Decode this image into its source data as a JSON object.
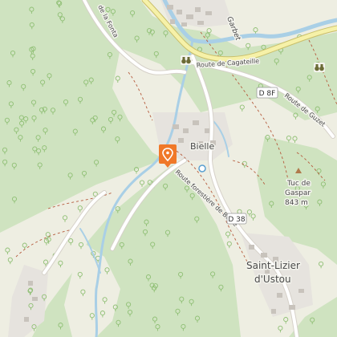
{
  "map": {
    "labels": {
      "river": "Garbet",
      "road_fonta": "de la Fonta",
      "road_cagateille": "Route de Cagateille",
      "road_guzet": "Route de Guzet",
      "road_forestiere": "Route forestière de Bielle",
      "village_bielle": "Bielle",
      "village_lizier_line1": "Saint-Lizier",
      "village_lizier_line2": "d'Ustou",
      "peak_name_line1": "Tuc de",
      "peak_name_line2": "Gaspar",
      "peak_elevation": "843 m"
    },
    "shields": {
      "d8f": "D 8F",
      "d38": "D 38"
    },
    "marker": {
      "icon": "location-pin-icon",
      "color": "#f07828"
    },
    "colors": {
      "forest": "#cfe3c0",
      "meadow": "#eeeee2",
      "road": "#ffffff",
      "main_road": "#f6f1a8",
      "water": "#a9cfe6",
      "track": "#b55a3c"
    }
  }
}
